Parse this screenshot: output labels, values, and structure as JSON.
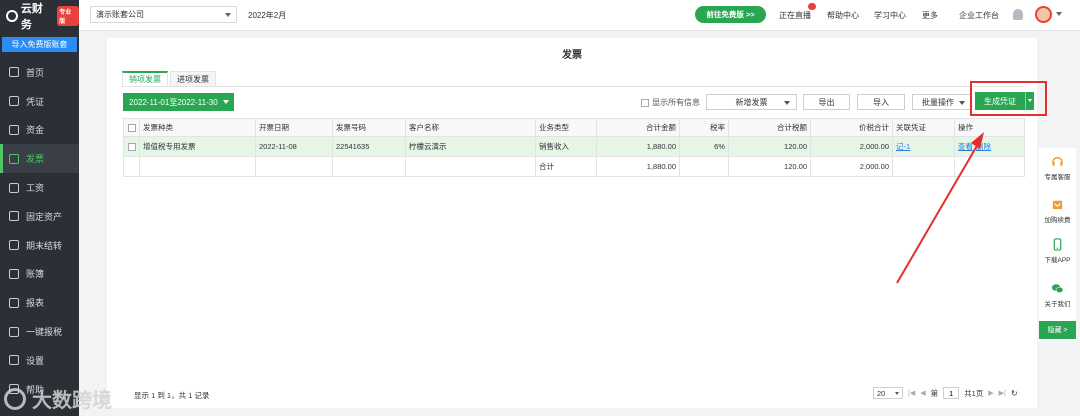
{
  "app": {
    "logo_text": "云财务",
    "logo_tag": "专业版"
  },
  "sidebar": {
    "import_button": "导入免费版账套",
    "items": [
      {
        "label": "首页",
        "icon": "home-icon"
      },
      {
        "label": "凭证",
        "icon": "voucher-icon"
      },
      {
        "label": "资金",
        "icon": "funds-icon"
      },
      {
        "label": "发票",
        "icon": "invoice-icon",
        "active": true
      },
      {
        "label": "工资",
        "icon": "salary-icon"
      },
      {
        "label": "固定资产",
        "icon": "fixed-assets-icon"
      },
      {
        "label": "期末结转",
        "icon": "period-close-icon"
      },
      {
        "label": "账簿",
        "icon": "ledger-icon"
      },
      {
        "label": "报表",
        "icon": "report-icon"
      },
      {
        "label": "一键报税",
        "icon": "tax-icon"
      },
      {
        "label": "设置",
        "icon": "settings-icon"
      },
      {
        "label": "帮助",
        "icon": "help-icon"
      }
    ]
  },
  "topbar": {
    "company": "演示账套公司",
    "period": "2022年2月",
    "free_button": "前往免费版 >>",
    "links": [
      "正在直播",
      "帮助中心",
      "学习中心",
      "更多",
      "企业工作台"
    ]
  },
  "page": {
    "title": "发票",
    "tabs": [
      "销项发票",
      "进项发票"
    ],
    "date_range": "2022-11-01至2022-11-30",
    "show_all_label": "显示所有信息",
    "buttons": {
      "new_invoice": "新增发票",
      "export": "导出",
      "import": "导入",
      "batch": "批量操作",
      "generate": "生成凭证"
    }
  },
  "table": {
    "headers": [
      "发票种类",
      "开票日期",
      "发票号码",
      "客户名称",
      "业务类型",
      "合计金额",
      "税率",
      "合计税额",
      "价税合计",
      "关联凭证",
      "操作"
    ],
    "rows": [
      {
        "type": "增值税专用发票",
        "date": "2022-11-08",
        "number": "22541635",
        "customer": "柠檬云演示",
        "biz": "销售收入",
        "amount": "1,880.00",
        "rate": "6%",
        "tax": "120.00",
        "total": "2,000.00",
        "voucher": "记-1",
        "op_view": "查看",
        "op_delete": "删除"
      },
      {
        "type": "",
        "date": "",
        "number": "",
        "customer": "",
        "biz": "合计",
        "amount": "1,880.00",
        "rate": "",
        "tax": "120.00",
        "total": "2,000.00",
        "voucher": "",
        "op_view": "",
        "op_delete": ""
      }
    ]
  },
  "pager": {
    "info": "显示 1 到 1，共 1 记录",
    "page_size": "20",
    "page_prefix": "第",
    "page": "1",
    "page_suffix": "共1页"
  },
  "side_tools": [
    "专属客服",
    "加购续费",
    "下载APP",
    "关于我们"
  ],
  "hide_button": "隐藏 >",
  "watermark": "大数跨境",
  "colors": {
    "brand_green": "#2aa653",
    "highlight_red": "#e52f2a",
    "sidebar_bg": "#2b2f36"
  }
}
